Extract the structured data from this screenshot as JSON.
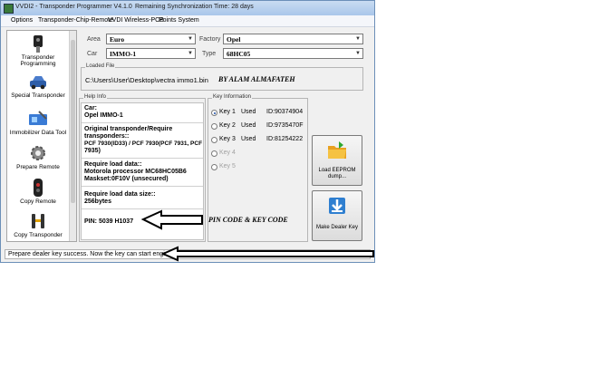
{
  "window": {
    "title": "VVDI2 - Transponder Programmer V4.1.0",
    "sync_status": "Remaining Synchronization Time: 28 days"
  },
  "menu": [
    "Options",
    "Transponder-Chip-Remote",
    "VVDI Wireless-PCB",
    "Points System"
  ],
  "sidebar": {
    "items": [
      {
        "label": "Transponder Programming",
        "icon": "key-icon"
      },
      {
        "label": "Special Transponder",
        "icon": "car-icon"
      },
      {
        "label": "Immobilizer Data Tool",
        "icon": "chip-icon"
      },
      {
        "label": "Prepare Remote",
        "icon": "gear-icon"
      },
      {
        "label": "Copy Remote",
        "icon": "remote-icon"
      },
      {
        "label": "Copy Transponder",
        "icon": "transponder-icon"
      }
    ]
  },
  "selectors": {
    "area_label": "Area",
    "area_value": "Euro",
    "factory_label": "Factory",
    "factory_value": "Opel",
    "car_label": "Car",
    "car_value": "IMMO-1",
    "type_label": "Type",
    "type_value": "68HC05"
  },
  "loaded_file": {
    "title": "Loaded File",
    "path": "C:\\Users\\User\\Desktop\\vectra immo1.bin"
  },
  "help_info": {
    "title": "Help Info",
    "car_header": "Car:",
    "car_value": "Opel IMMO-1",
    "transponder_lines": [
      "Original transponder/Require",
      "transponders::",
      "PCF 7930(ID33) / PCF 7930(PCF 7931, PCF",
      "7935)"
    ],
    "load_lines": [
      "Require load data::",
      "Motorola processor MC68HC05B6",
      "Maskset:0F10V (unsecured)"
    ],
    "size_lines": [
      "Require load data size::",
      "256bytes"
    ],
    "pin": "PIN: 5039  H1037"
  },
  "key_info": {
    "title": "Key Information",
    "keys": [
      {
        "name": "Key 1",
        "status": "Used",
        "id": "ID:90374904",
        "checked": true,
        "enabled": true
      },
      {
        "name": "Key 2",
        "status": "Used",
        "id": "ID:9735470F",
        "checked": false,
        "enabled": true
      },
      {
        "name": "Key 3",
        "status": "Used",
        "id": "ID:81254222",
        "checked": false,
        "enabled": true
      },
      {
        "name": "Key 4",
        "status": "",
        "id": "",
        "checked": false,
        "enabled": false
      },
      {
        "name": "Key 5",
        "status": "",
        "id": "",
        "checked": false,
        "enabled": false
      }
    ]
  },
  "buttons": {
    "load_eeprom": "Load EEPROM dump...",
    "make_dealer_key": "Make Dealer Key"
  },
  "annotations": {
    "author": "BY ALAM ALMAFATEH",
    "pin_note": "PIN CODE & KEY CODE"
  },
  "status": {
    "text": "Prepare dealer key success. Now the key can start engine."
  },
  "colors": {
    "title_bar": "#b8d1ef",
    "window_bg": "#f0f0f0",
    "radio_dot": "#1b4ea8"
  }
}
